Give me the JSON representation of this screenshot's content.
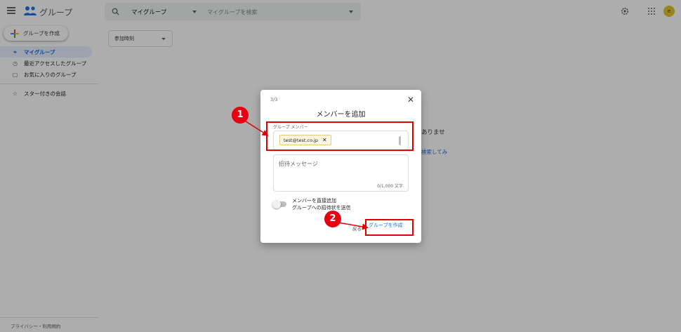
{
  "app": {
    "title": "グループ",
    "menu_icon": "hamburger-menu-icon",
    "logo_icon": "groups-logo-icon",
    "brand_colors": {
      "blue": "#1a73e8",
      "annotation_red": "#e00000"
    }
  },
  "search": {
    "scope_label": "マイグループ",
    "placeholder": "マイグループを検索"
  },
  "header": {
    "settings_icon": "gear-icon",
    "apps_icon": "apps-grid-icon",
    "avatar_letter": "e"
  },
  "sidebar": {
    "create_label": "グループを作成",
    "items": [
      {
        "label": "マイグループ",
        "icon": "groups-icon",
        "active": true
      },
      {
        "label": "最近アクセスしたグループ",
        "icon": "clock-icon",
        "active": false
      },
      {
        "label": "お気に入りのグループ",
        "icon": "folder-star-icon",
        "active": false
      }
    ],
    "starred_label": "スター付きの会話",
    "footer": "プライバシー・利用規約"
  },
  "main": {
    "filter_label": "参加時刻",
    "empty_message_fragment": "ありませ",
    "empty_link_fragment": "検索してみ"
  },
  "dialog": {
    "step": "3/3",
    "title": "メンバーを追加",
    "members_label": "グループ メンバー",
    "member_chip": "test@test.co.jp",
    "message_placeholder": "招待メッセージ",
    "char_count": "0/1,000 文字",
    "toggle_label_line1": "メンバーを直接追加",
    "toggle_label_line2": "グループへの招待状を送信",
    "back_label": "戻る",
    "create_label": "グループを作成"
  },
  "annotations": {
    "badge_1": "1",
    "badge_2": "2"
  }
}
